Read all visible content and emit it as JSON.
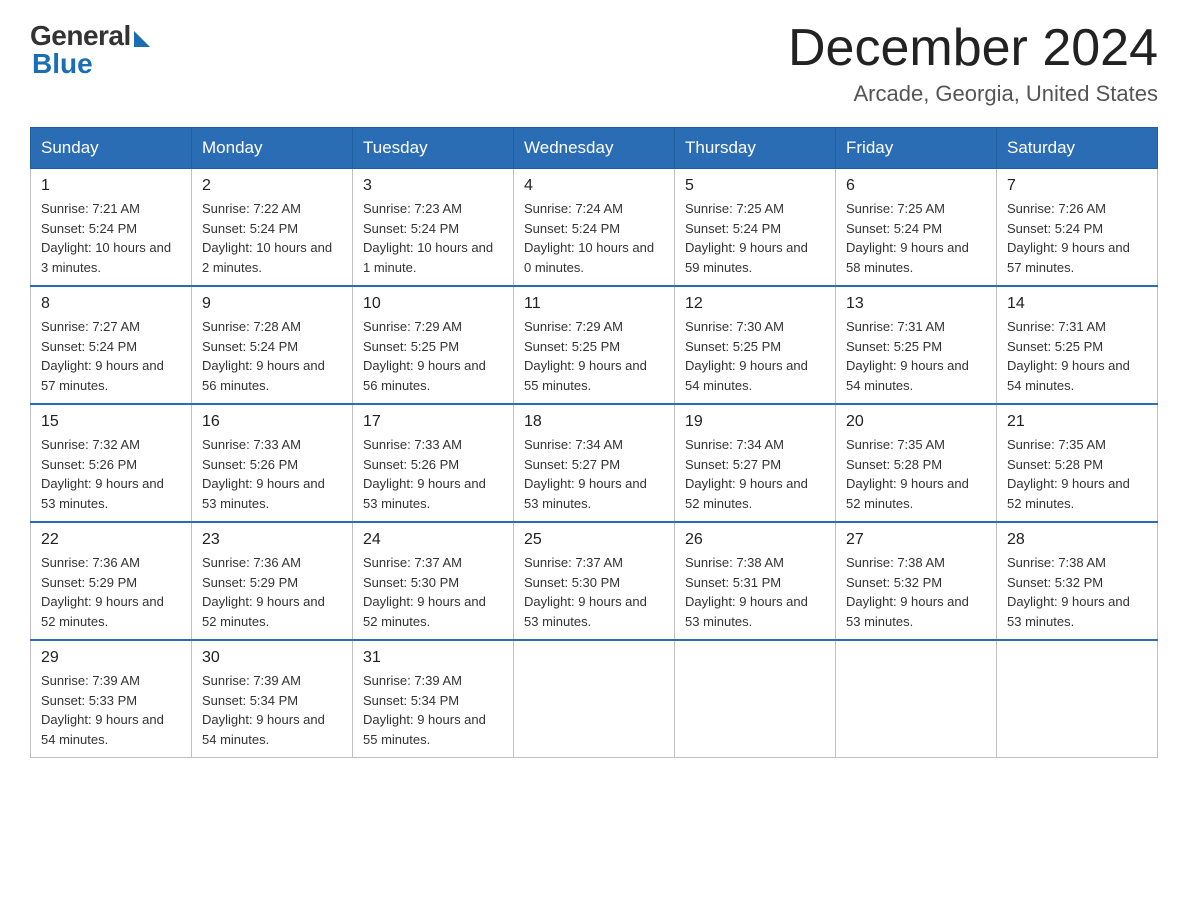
{
  "logo": {
    "general": "General",
    "blue": "Blue"
  },
  "title": "December 2024",
  "location": "Arcade, Georgia, United States",
  "days_of_week": [
    "Sunday",
    "Monday",
    "Tuesday",
    "Wednesday",
    "Thursday",
    "Friday",
    "Saturday"
  ],
  "weeks": [
    [
      {
        "day": "1",
        "sunrise": "7:21 AM",
        "sunset": "5:24 PM",
        "daylight": "10 hours and 3 minutes."
      },
      {
        "day": "2",
        "sunrise": "7:22 AM",
        "sunset": "5:24 PM",
        "daylight": "10 hours and 2 minutes."
      },
      {
        "day": "3",
        "sunrise": "7:23 AM",
        "sunset": "5:24 PM",
        "daylight": "10 hours and 1 minute."
      },
      {
        "day": "4",
        "sunrise": "7:24 AM",
        "sunset": "5:24 PM",
        "daylight": "10 hours and 0 minutes."
      },
      {
        "day": "5",
        "sunrise": "7:25 AM",
        "sunset": "5:24 PM",
        "daylight": "9 hours and 59 minutes."
      },
      {
        "day": "6",
        "sunrise": "7:25 AM",
        "sunset": "5:24 PM",
        "daylight": "9 hours and 58 minutes."
      },
      {
        "day": "7",
        "sunrise": "7:26 AM",
        "sunset": "5:24 PM",
        "daylight": "9 hours and 57 minutes."
      }
    ],
    [
      {
        "day": "8",
        "sunrise": "7:27 AM",
        "sunset": "5:24 PM",
        "daylight": "9 hours and 57 minutes."
      },
      {
        "day": "9",
        "sunrise": "7:28 AM",
        "sunset": "5:24 PM",
        "daylight": "9 hours and 56 minutes."
      },
      {
        "day": "10",
        "sunrise": "7:29 AM",
        "sunset": "5:25 PM",
        "daylight": "9 hours and 56 minutes."
      },
      {
        "day": "11",
        "sunrise": "7:29 AM",
        "sunset": "5:25 PM",
        "daylight": "9 hours and 55 minutes."
      },
      {
        "day": "12",
        "sunrise": "7:30 AM",
        "sunset": "5:25 PM",
        "daylight": "9 hours and 54 minutes."
      },
      {
        "day": "13",
        "sunrise": "7:31 AM",
        "sunset": "5:25 PM",
        "daylight": "9 hours and 54 minutes."
      },
      {
        "day": "14",
        "sunrise": "7:31 AM",
        "sunset": "5:25 PM",
        "daylight": "9 hours and 54 minutes."
      }
    ],
    [
      {
        "day": "15",
        "sunrise": "7:32 AM",
        "sunset": "5:26 PM",
        "daylight": "9 hours and 53 minutes."
      },
      {
        "day": "16",
        "sunrise": "7:33 AM",
        "sunset": "5:26 PM",
        "daylight": "9 hours and 53 minutes."
      },
      {
        "day": "17",
        "sunrise": "7:33 AM",
        "sunset": "5:26 PM",
        "daylight": "9 hours and 53 minutes."
      },
      {
        "day": "18",
        "sunrise": "7:34 AM",
        "sunset": "5:27 PM",
        "daylight": "9 hours and 53 minutes."
      },
      {
        "day": "19",
        "sunrise": "7:34 AM",
        "sunset": "5:27 PM",
        "daylight": "9 hours and 52 minutes."
      },
      {
        "day": "20",
        "sunrise": "7:35 AM",
        "sunset": "5:28 PM",
        "daylight": "9 hours and 52 minutes."
      },
      {
        "day": "21",
        "sunrise": "7:35 AM",
        "sunset": "5:28 PM",
        "daylight": "9 hours and 52 minutes."
      }
    ],
    [
      {
        "day": "22",
        "sunrise": "7:36 AM",
        "sunset": "5:29 PM",
        "daylight": "9 hours and 52 minutes."
      },
      {
        "day": "23",
        "sunrise": "7:36 AM",
        "sunset": "5:29 PM",
        "daylight": "9 hours and 52 minutes."
      },
      {
        "day": "24",
        "sunrise": "7:37 AM",
        "sunset": "5:30 PM",
        "daylight": "9 hours and 52 minutes."
      },
      {
        "day": "25",
        "sunrise": "7:37 AM",
        "sunset": "5:30 PM",
        "daylight": "9 hours and 53 minutes."
      },
      {
        "day": "26",
        "sunrise": "7:38 AM",
        "sunset": "5:31 PM",
        "daylight": "9 hours and 53 minutes."
      },
      {
        "day": "27",
        "sunrise": "7:38 AM",
        "sunset": "5:32 PM",
        "daylight": "9 hours and 53 minutes."
      },
      {
        "day": "28",
        "sunrise": "7:38 AM",
        "sunset": "5:32 PM",
        "daylight": "9 hours and 53 minutes."
      }
    ],
    [
      {
        "day": "29",
        "sunrise": "7:39 AM",
        "sunset": "5:33 PM",
        "daylight": "9 hours and 54 minutes."
      },
      {
        "day": "30",
        "sunrise": "7:39 AM",
        "sunset": "5:34 PM",
        "daylight": "9 hours and 54 minutes."
      },
      {
        "day": "31",
        "sunrise": "7:39 AM",
        "sunset": "5:34 PM",
        "daylight": "9 hours and 55 minutes."
      },
      null,
      null,
      null,
      null
    ]
  ],
  "labels": {
    "sunrise": "Sunrise:",
    "sunset": "Sunset:",
    "daylight": "Daylight:"
  }
}
